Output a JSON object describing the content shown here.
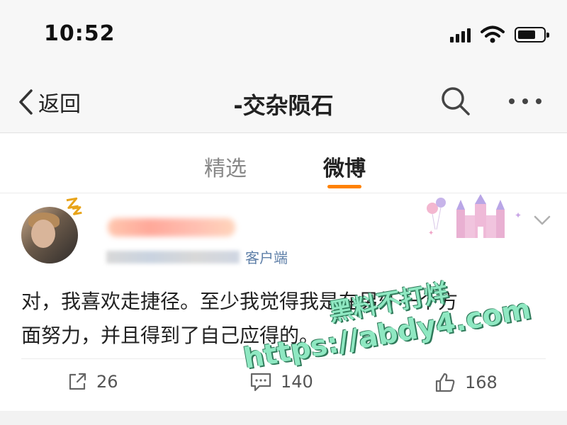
{
  "status_bar": {
    "time": "10:52"
  },
  "nav": {
    "back_label": "返回",
    "title": "-交杂陨石"
  },
  "tabs": [
    {
      "label": "精选",
      "active": false
    },
    {
      "label": "微博",
      "active": true
    }
  ],
  "post": {
    "source": "客户端",
    "text_line1": "对，我喜欢走捷径。至少我觉得我是在另外一个方",
    "text_line2": "面努力，并且得到了自己应得的。",
    "actions": {
      "repost_count": "26",
      "comment_count": "140",
      "like_count": "168"
    }
  },
  "watermark": {
    "line1": "黑料不打烊",
    "line2": "https://abdy4.com"
  },
  "colors": {
    "accent": "#ff8200",
    "link": "#5e7fa8",
    "watermark": "#8fe8c2"
  },
  "icons": [
    "signal-icon",
    "wifi-icon",
    "battery-icon",
    "back-chevron-icon",
    "search-icon",
    "more-icon",
    "chevron-down-icon",
    "repost-icon",
    "comment-icon",
    "like-icon"
  ]
}
